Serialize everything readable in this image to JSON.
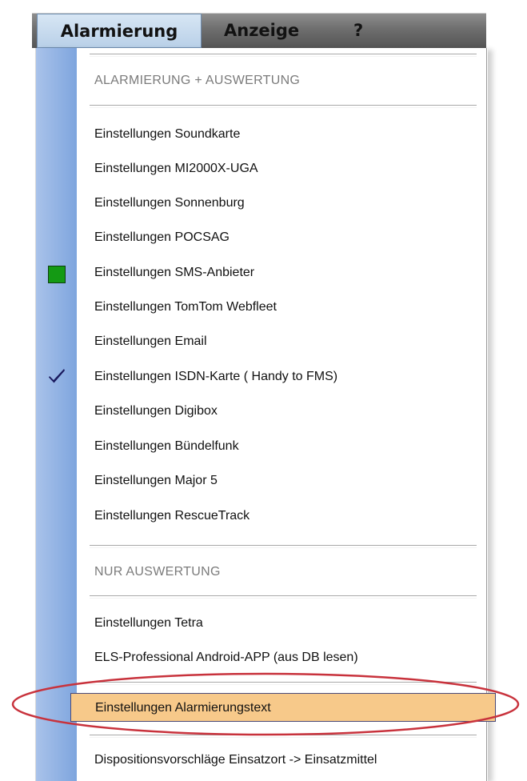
{
  "menubar": {
    "items": [
      {
        "label": "Alarmierung"
      },
      {
        "label": "Anzeige"
      },
      {
        "label": "?"
      }
    ]
  },
  "dropdown": {
    "section1": "ALARMIERUNG + AUSWERTUNG",
    "items1": [
      {
        "label": "Einstellungen Soundkarte"
      },
      {
        "label": "Einstellungen MI2000X-UGA"
      },
      {
        "label": "Einstellungen Sonnenburg"
      },
      {
        "label": "Einstellungen POCSAG"
      },
      {
        "label": "Einstellungen SMS-Anbieter",
        "indicator": "green-square-icon"
      },
      {
        "label": "Einstellungen TomTom Webfleet"
      },
      {
        "label": "Einstellungen Email"
      },
      {
        "label": "Einstellungen ISDN-Karte ( Handy to FMS)",
        "indicator": "checkmark-icon"
      },
      {
        "label": "Einstellungen Digibox"
      },
      {
        "label": "Einstellungen Bündelfunk"
      },
      {
        "label": "Einstellungen Major 5"
      },
      {
        "label": "Einstellungen RescueTrack"
      }
    ],
    "section2": "NUR AUSWERTUNG",
    "items2": [
      {
        "label": "Einstellungen Tetra"
      },
      {
        "label": "ELS-Professional Android-APP (aus DB lesen)"
      }
    ],
    "highlighted": {
      "label": "Einstellungen Alarmierungstext"
    },
    "last": {
      "label": "Dispositionsvorschläge Einsatzort -> Einsatzmittel"
    }
  },
  "colors": {
    "highlight": "#f7c98a",
    "annotation_oval": "#c8323c",
    "gutter": "#7ea5de",
    "indicator_green": "#149a14",
    "checkmark": "#1a1a5e"
  }
}
